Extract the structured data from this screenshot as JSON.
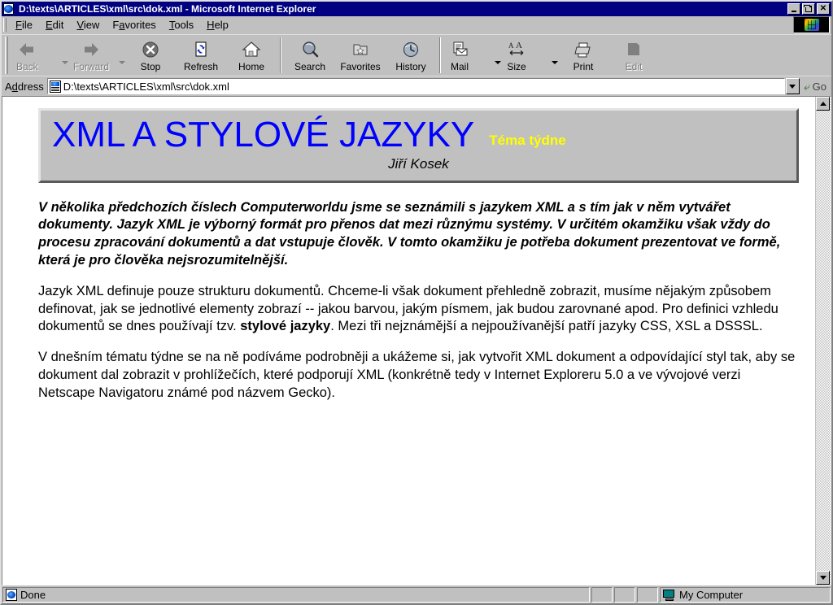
{
  "window": {
    "title": "D:\\texts\\ARTICLES\\xml\\src\\dok.xml - Microsoft Internet Explorer",
    "title_icon": "ie-document-icon",
    "minimize_label": "Minimize",
    "restore_label": "Restore",
    "close_label": "Close"
  },
  "menubar": {
    "items": [
      {
        "label": "File",
        "accel": "F"
      },
      {
        "label": "Edit",
        "accel": "E"
      },
      {
        "label": "View",
        "accel": "V"
      },
      {
        "label": "Favorites",
        "accel": "a"
      },
      {
        "label": "Tools",
        "accel": "T"
      },
      {
        "label": "Help",
        "accel": "H"
      }
    ],
    "brand_icon": "internet-explorer-logo-icon"
  },
  "toolbar": {
    "buttons": [
      {
        "label": "Back",
        "icon": "arrow-left-icon",
        "enabled": false,
        "has_menu": true
      },
      {
        "label": "Forward",
        "icon": "arrow-right-icon",
        "enabled": false,
        "has_menu": true
      },
      {
        "label": "Stop",
        "icon": "stop-icon",
        "enabled": true,
        "has_menu": false
      },
      {
        "label": "Refresh",
        "icon": "refresh-icon",
        "enabled": true,
        "has_menu": false
      },
      {
        "label": "Home",
        "icon": "home-icon",
        "enabled": true,
        "has_menu": false
      },
      {
        "label": "Search",
        "icon": "search-icon",
        "enabled": true,
        "has_menu": false
      },
      {
        "label": "Favorites",
        "icon": "favorites-star-folder-icon",
        "enabled": true,
        "has_menu": false
      },
      {
        "label": "History",
        "icon": "history-clock-icon",
        "enabled": true,
        "has_menu": false
      },
      {
        "label": "Mail",
        "icon": "mail-icon",
        "enabled": true,
        "has_menu": true
      },
      {
        "label": "Size",
        "icon": "font-size-icon",
        "enabled": true,
        "has_menu": true
      },
      {
        "label": "Print",
        "icon": "printer-icon",
        "enabled": true,
        "has_menu": false
      },
      {
        "label": "Edit",
        "icon": "edit-page-icon",
        "enabled": false,
        "has_menu": false
      }
    ]
  },
  "address": {
    "label": "Address",
    "value": "D:\\texts\\ARTICLES\\xml\\src\\dok.xml",
    "placeholder": "",
    "doc_icon": "xml-document-icon",
    "dropdown_icon": "chevron-down-icon",
    "go_label": "Go",
    "go_icon": "go-arrow-icon"
  },
  "document": {
    "title": "XML A STYLOVÉ JAZYKY",
    "badge": "Téma týdne",
    "author": "Jiří Kosek",
    "lead": "V několika předchozích číslech Computerworldu jsme se seznámili s jazykem XML a s tím jak v něm vytvářet dokumenty. Jazyk XML je výborný formát pro přenos dat mezi různýmu systémy. V určitém okamžiku však vždy do procesu zpracování dokumentů a dat vstupuje člověk. V tomto okamžiku je potřeba dokument prezentovat ve formě, která je pro člověka nejsrozumitelnější.",
    "paragraph2_part1": "Jazyk XML definuje pouze strukturu dokumentů. Chceme-li však dokument přehledně zobrazit, musíme nějakým způsobem definovat, jak se jednotlivé elementy zobrazí -- jakou barvou, jakým písmem, jak budou zarovnané apod. Pro definici vzhledu dokumentů se dnes používají tzv. ",
    "paragraph2_bold": "stylové jazyky",
    "paragraph2_part2": ". Mezi tři nejznámější a nejpoužívanější patří jazyky CSS, XSL a DSSSL.",
    "paragraph3": "V dnešním tématu týdne se na ně podíváme podrobněji a ukážeme si, jak vytvořit XML dokument a odpovídající styl tak, aby se dokument dal zobrazit v prohlížečích, které podporují XML (konkrétně tedy v Internet Exploreru 5.0 a ve vývojové verzi Netscape Navigatoru známé pod názvem Gecko).",
    "colors": {
      "title": "#0000ff",
      "badge": "#ffff00",
      "banner_background": "#c0c0c0",
      "body_text": "#000000",
      "page_background": "#ffffff"
    }
  },
  "scrollbar": {
    "up_icon": "scroll-up-arrow-icon",
    "down_icon": "scroll-down-arrow-icon"
  },
  "statusbar": {
    "message": "Done",
    "message_icon": "ie-page-icon",
    "zone": "My Computer",
    "zone_icon": "my-computer-monitor-icon"
  }
}
